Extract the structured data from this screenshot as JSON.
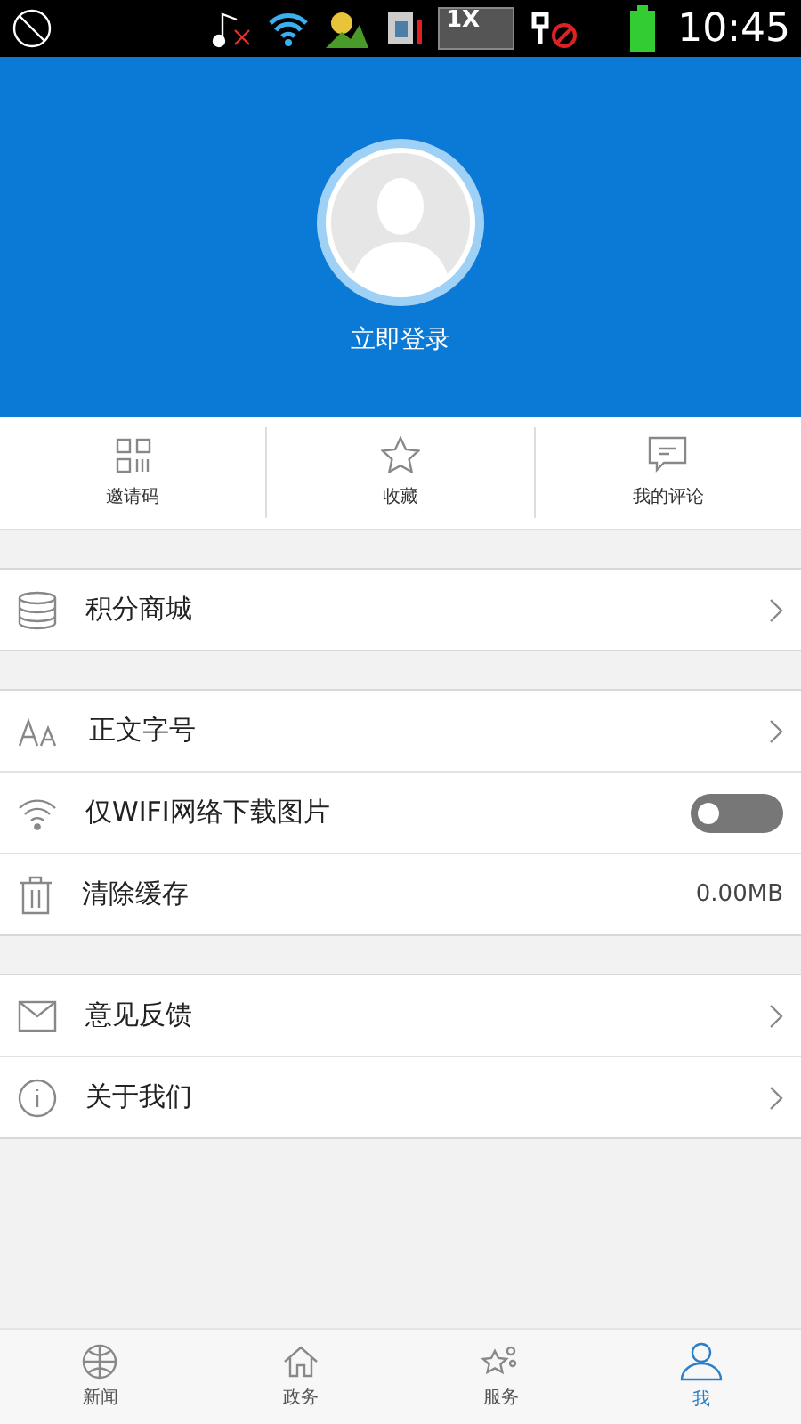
{
  "status_bar": {
    "network_label": "1X",
    "time": "10:45"
  },
  "profile": {
    "login": "立即登录"
  },
  "quick_actions": [
    {
      "label": "邀请码"
    },
    {
      "label": "收藏"
    },
    {
      "label": "我的评论"
    }
  ],
  "sections": [
    {
      "rows": [
        {
          "label": "积分商城",
          "kind": "link"
        }
      ]
    },
    {
      "rows": [
        {
          "label": "正文字号",
          "kind": "link"
        },
        {
          "label": "仅WIFI网络下载图片",
          "kind": "toggle",
          "on": false
        },
        {
          "label": "清除缓存",
          "kind": "value",
          "value": "0.00MB"
        }
      ]
    },
    {
      "rows": [
        {
          "label": "意见反馈",
          "kind": "link"
        },
        {
          "label": "关于我们",
          "kind": "link"
        }
      ]
    }
  ],
  "tab_bar": [
    {
      "label": "新闻",
      "selected": false
    },
    {
      "label": "政务",
      "selected": false
    },
    {
      "label": "服务",
      "selected": false
    },
    {
      "label": "我",
      "selected": true
    }
  ]
}
